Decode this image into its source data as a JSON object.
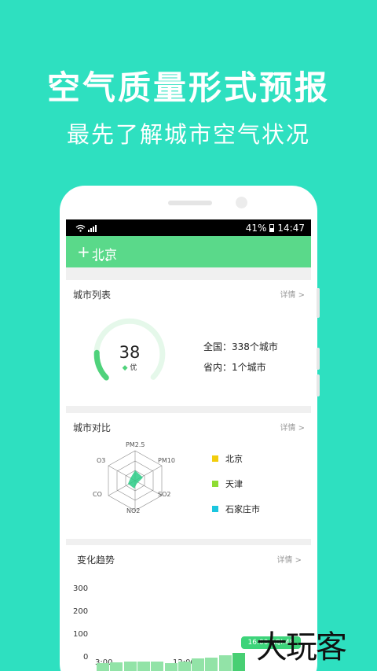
{
  "promo": {
    "headline": "空气质量形式预报",
    "subline": "最先了解城市空气状况"
  },
  "statusbar": {
    "battery": "41%",
    "time": "14:47"
  },
  "appbar": {
    "plus": "+",
    "city": "北京"
  },
  "city_list": {
    "title": "城市列表",
    "link": "详情 >",
    "aqi": "38",
    "level": "优",
    "national": "全国：338个城市",
    "province": "省内：1个城市"
  },
  "compare": {
    "title": "城市对比",
    "link": "详情 >",
    "radar_labels": [
      "PM2.5",
      "PM10",
      "SO2",
      "NO2",
      "CO",
      "O3"
    ],
    "legend": [
      {
        "name": "北京",
        "color": "#f2cd0d"
      },
      {
        "name": "天津",
        "color": "#8edc33"
      },
      {
        "name": "石家庄市",
        "color": "#1bc6df"
      }
    ]
  },
  "trend": {
    "title": "变化趋势",
    "link": "详情 >",
    "tooltip": "16:00 AQI:48"
  },
  "chart_data": {
    "type": "bar",
    "title": "变化趋势",
    "ylim": [
      0,
      300
    ],
    "y_ticks": [
      "300",
      "200",
      "100",
      "0"
    ],
    "x_ticks": [
      "3:00",
      "12:00"
    ],
    "values": [
      35,
      38,
      43,
      42,
      40,
      35,
      42,
      55,
      58,
      68,
      80
    ],
    "highlight_last": true
  },
  "watermark": "大玩客"
}
